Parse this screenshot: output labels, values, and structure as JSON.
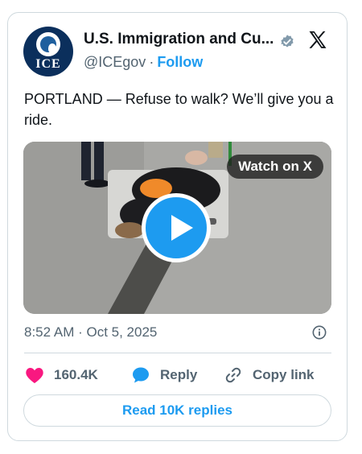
{
  "account": {
    "avatar_text": "ICE",
    "name": "U.S. Immigration and Cu...",
    "handle": "@ICEgov",
    "separator": "·",
    "follow_label": "Follow",
    "verified_icon": "verified-badge-icon",
    "platform_icon": "x-logo-icon"
  },
  "post": {
    "text": "PORTLAND — Refuse to walk? We’ll give you a ride.",
    "timestamp": "8:52 AM · Oct 5, 2025"
  },
  "media": {
    "watch_label": "Watch on X",
    "play_icon": "play-icon"
  },
  "actions": {
    "likes_count": "160.4K",
    "reply_label": "Reply",
    "copy_link_label": "Copy link",
    "read_replies_label": "Read 10K replies"
  },
  "colors": {
    "accent": "#1d9bf0",
    "like": "#f91880",
    "muted": "#536471",
    "border": "#cfd9de"
  }
}
